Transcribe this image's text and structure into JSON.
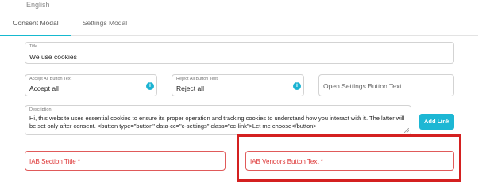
{
  "language": {
    "label": "English"
  },
  "tabs": [
    {
      "label": "Consent Modal",
      "active": true
    },
    {
      "label": "Settings Modal",
      "active": false
    }
  ],
  "form": {
    "title": {
      "label": "Title",
      "value": "We use cookies"
    },
    "accept_all": {
      "label": "Accept All Button Text",
      "value": "Accept all"
    },
    "reject_all": {
      "label": "Reject All Button Text",
      "value": "Reject all"
    },
    "open_settings": {
      "placeholder": "Open Settings Button Text"
    },
    "description": {
      "label": "Description",
      "value": "Hi, this website uses essential cookies to ensure its proper operation and tracking cookies to understand how you interact with it. The latter will be set only after consent. <button type=\"button\" data-cc=\"c-settings\" class=\"cc-link\">Let me choose</button>"
    },
    "add_link_label": "Add Link",
    "iab_section_title": {
      "placeholder": "IAB Section Title *"
    },
    "iab_vendors_button": {
      "placeholder": "IAB Vendors Button Text *"
    }
  },
  "colors": {
    "accent": "#1db7d4",
    "error": "#d33333",
    "highlight": "#d42020"
  },
  "icons": [
    "info-icon",
    "resize-grip-icon"
  ]
}
